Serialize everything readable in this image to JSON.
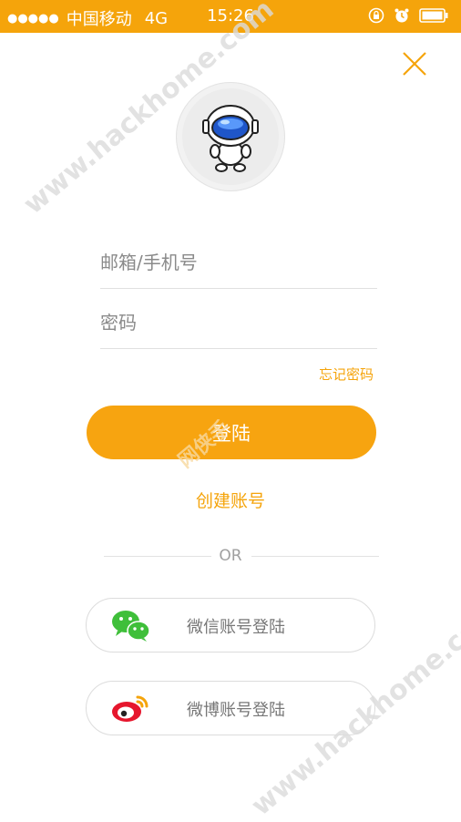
{
  "status_bar": {
    "carrier": "中国移动",
    "network": "4G",
    "time": "15:26"
  },
  "login": {
    "account_placeholder": "邮箱/手机号",
    "password_placeholder": "密码",
    "forgot_password": "忘记密码",
    "login_button": "登陆",
    "create_account": "创建账号",
    "or_text": "OR"
  },
  "social": {
    "wechat_label": "微信账号登陆",
    "weibo_label": "微博账号登陆"
  },
  "watermarks": {
    "top": "www.hackhome.com",
    "bottom": "www.hackhome.com",
    "middle": "网侠手"
  },
  "colors": {
    "accent": "#f5a40b",
    "wechat": "#3fbf3a",
    "weibo": "#e6162d"
  }
}
